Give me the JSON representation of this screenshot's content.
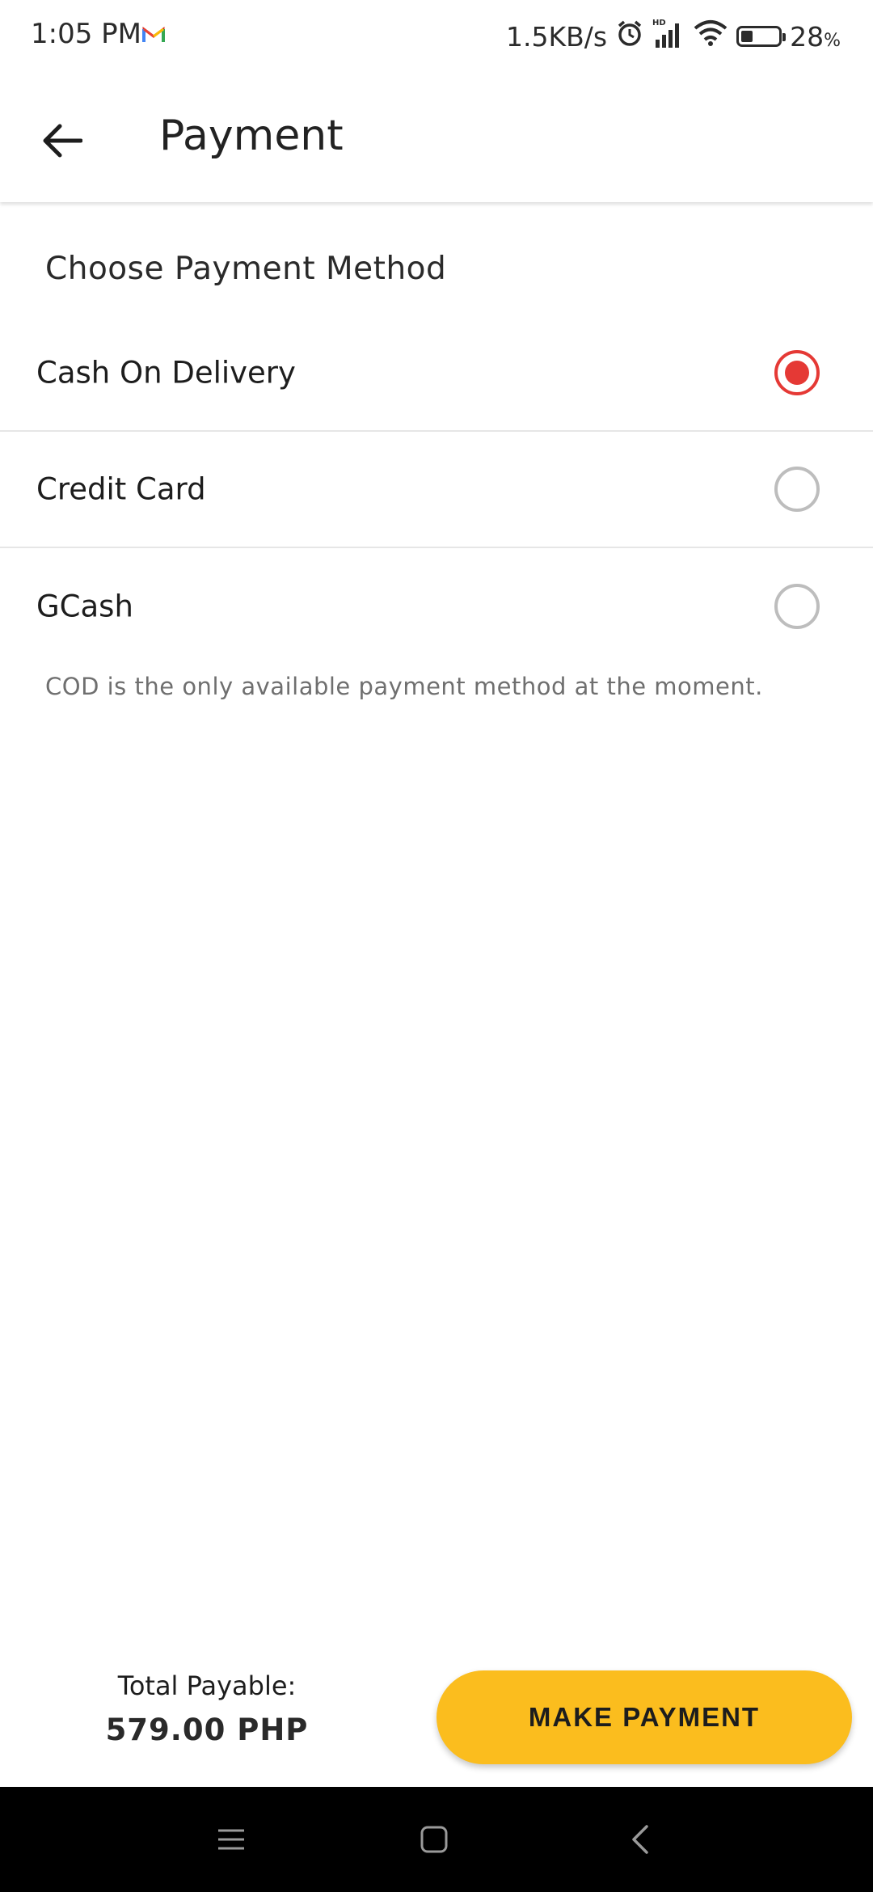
{
  "status_bar": {
    "time": "1:05 PM",
    "network_speed": "1.5KB/s",
    "battery_percent": "28",
    "battery_unit": "%",
    "battery_level": 0.28,
    "icons": [
      "gmail-icon",
      "alarm-icon",
      "hd-signal-icon",
      "wifi-icon",
      "battery-icon"
    ]
  },
  "app_bar": {
    "title": "Payment",
    "back_icon": "arrow-left-icon"
  },
  "payment": {
    "heading": "Choose Payment Method",
    "options": [
      {
        "label": "Cash On Delivery",
        "selected": true
      },
      {
        "label": "Credit Card",
        "selected": false
      },
      {
        "label": "GCash",
        "selected": false
      }
    ],
    "note": "COD is the only available payment method at the moment."
  },
  "footer": {
    "total_label": "Total Payable:",
    "total_value": "579.00 PHP",
    "button_label": "MAKE PAYMENT"
  },
  "nav_bar": {
    "icons": [
      "menu-icon",
      "home-icon",
      "back-icon"
    ]
  },
  "colors": {
    "accent": "#fbbd1e",
    "radio_selected": "#e53935",
    "radio_unselected": "#bdbdbd"
  }
}
